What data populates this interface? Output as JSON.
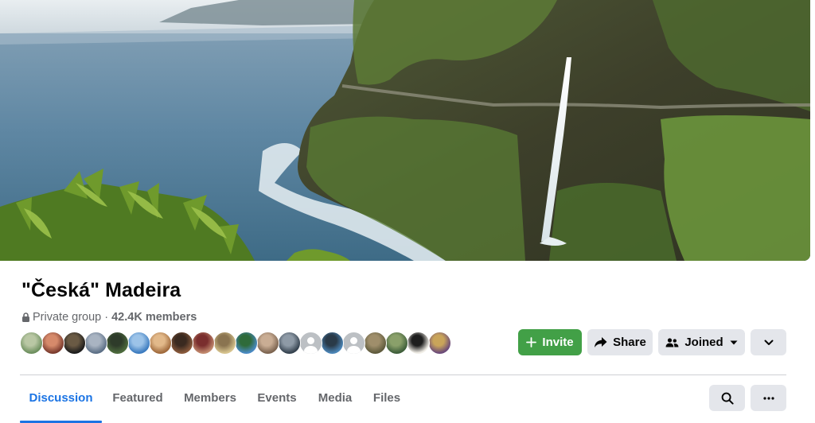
{
  "group": {
    "name": "\"Česká\" Madeira",
    "privacy": "Private group",
    "separator": "·",
    "members": "42.4K members"
  },
  "avatars": [
    {
      "kind": "photo",
      "colors": [
        "#6d8f5e",
        "#b9c7a4"
      ]
    },
    {
      "kind": "photo",
      "colors": [
        "#7a3b2e",
        "#d68a6b"
      ]
    },
    {
      "kind": "photo",
      "colors": [
        "#1c1c1c",
        "#6a5a44"
      ]
    },
    {
      "kind": "photo",
      "colors": [
        "#5c6f86",
        "#a9b4c2"
      ]
    },
    {
      "kind": "photo",
      "colors": [
        "#4d6b3d",
        "#2e3b2a"
      ]
    },
    {
      "kind": "photo",
      "colors": [
        "#3b7bbf",
        "#9cc3e8"
      ]
    },
    {
      "kind": "photo",
      "colors": [
        "#a06a3c",
        "#e2b98a"
      ]
    },
    {
      "kind": "photo",
      "colors": [
        "#8a5a3c",
        "#3a2a20"
      ]
    },
    {
      "kind": "photo",
      "colors": [
        "#c28a6e",
        "#7a2e2e"
      ]
    },
    {
      "kind": "photo",
      "colors": [
        "#d7c48e",
        "#8a7450"
      ]
    },
    {
      "kind": "photo",
      "colors": [
        "#4a8ac4",
        "#2f6b3a"
      ]
    },
    {
      "kind": "photo",
      "colors": [
        "#7c6450",
        "#c9ad94"
      ]
    },
    {
      "kind": "photo",
      "colors": [
        "#35424f",
        "#8e9aa6"
      ]
    },
    {
      "kind": "generic"
    },
    {
      "kind": "photo",
      "colors": [
        "#4b86b8",
        "#2a3a48"
      ]
    },
    {
      "kind": "generic"
    },
    {
      "kind": "photo",
      "colors": [
        "#5e5a3c",
        "#9f8e6b"
      ]
    },
    {
      "kind": "photo",
      "colors": [
        "#3e5e3a",
        "#8aa06a"
      ]
    },
    {
      "kind": "photo",
      "colors": [
        "#f2efe8",
        "#1e1e1e"
      ]
    },
    {
      "kind": "photo",
      "colors": [
        "#6b4a7a",
        "#c9a45a"
      ]
    }
  ],
  "actions": {
    "invite": "Invite",
    "share": "Share",
    "joined": "Joined"
  },
  "tabs": [
    {
      "label": "Discussion",
      "active": true
    },
    {
      "label": "Featured",
      "active": false
    },
    {
      "label": "Members",
      "active": false
    },
    {
      "label": "Events",
      "active": false
    },
    {
      "label": "Media",
      "active": false
    },
    {
      "label": "Files",
      "active": false
    }
  ],
  "colors": {
    "accent": "#1b74e4",
    "invite_green": "#42a047",
    "button_gray": "#e4e6eb",
    "secondary_text": "#65676b"
  },
  "icons": {
    "invite": "plus-icon",
    "share": "share-arrow-icon",
    "joined": "group-people-icon",
    "joined_dropdown": "caret-down-icon",
    "more": "chevron-down-icon",
    "search": "search-icon",
    "overflow": "more-dots-icon",
    "privacy": "lock-icon"
  }
}
